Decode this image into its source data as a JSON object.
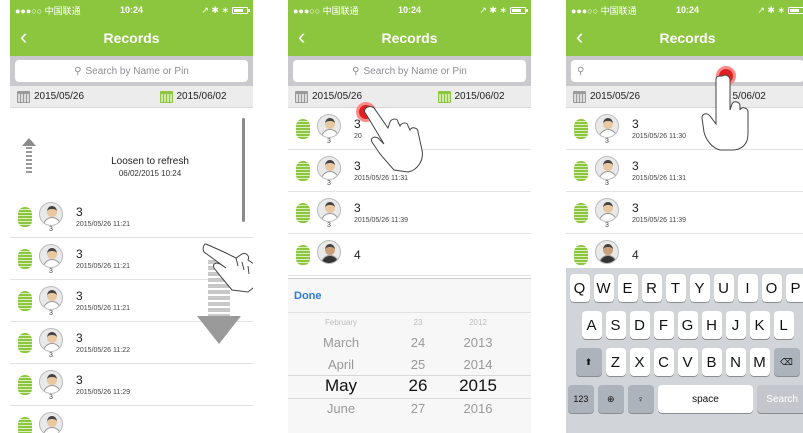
{
  "status": {
    "carrier": "●●●○○ 中国联通",
    "time": "10:24",
    "icons": "↗ ✱ ∗"
  },
  "nav": {
    "title": "Records",
    "back": "‹"
  },
  "search": {
    "placeholder": "Search by Name or Pin"
  },
  "dates": {
    "start": "2015/05/26",
    "end": "2015/06/02",
    "end_partial": "5/06/02"
  },
  "refresh": {
    "label": "Loosen to refresh",
    "time": "06/02/2015 10:24"
  },
  "screen1": {
    "records": [
      {
        "name": "3",
        "pin": "3",
        "time": "2015/05/26 11:21"
      },
      {
        "name": "3",
        "pin": "3",
        "time": "2015/05/26 11:21"
      },
      {
        "name": "3",
        "pin": "3",
        "time": "2015/05/26 11:21"
      },
      {
        "name": "3",
        "pin": "3",
        "time": "2015/05/26 11:22"
      },
      {
        "name": "3",
        "pin": "3",
        "time": "2015/05/26 11:29"
      }
    ]
  },
  "screen2": {
    "records": [
      {
        "name": "3",
        "pin": "3",
        "time": "20"
      },
      {
        "name": "3",
        "pin": "3",
        "time": "2015/05/26 11:31"
      },
      {
        "name": "3",
        "pin": "3",
        "time": "2015/05/26 11:39"
      },
      {
        "name": "4",
        "pin": "",
        "time": ""
      }
    ],
    "partial_time": "0",
    "done_label": "Done",
    "picker": {
      "months": [
        "February",
        "March",
        "April",
        "May",
        "June"
      ],
      "days": [
        "23",
        "24",
        "25",
        "26",
        "27"
      ],
      "years": [
        "2012",
        "2013",
        "2014",
        "2015",
        "2016"
      ],
      "selected_index": 3
    }
  },
  "screen3": {
    "records": [
      {
        "name": "3",
        "pin": "3",
        "time": "2015/05/26 11:30"
      },
      {
        "name": "3",
        "pin": "3",
        "time": "2015/05/26 11:31"
      },
      {
        "name": "3",
        "pin": "3",
        "time": "2015/05/26 11:39"
      },
      {
        "name": "4",
        "pin": "",
        "time": ""
      }
    ],
    "keyboard": {
      "row1": [
        "Q",
        "W",
        "E",
        "R",
        "T",
        "Y",
        "U",
        "I",
        "O",
        "P"
      ],
      "row2": [
        "A",
        "S",
        "D",
        "F",
        "G",
        "H",
        "J",
        "K",
        "L"
      ],
      "row3": [
        "Z",
        "X",
        "C",
        "V",
        "B",
        "N",
        "M"
      ],
      "numbers_label": "123",
      "space_label": "space",
      "search_label": "Search"
    }
  }
}
